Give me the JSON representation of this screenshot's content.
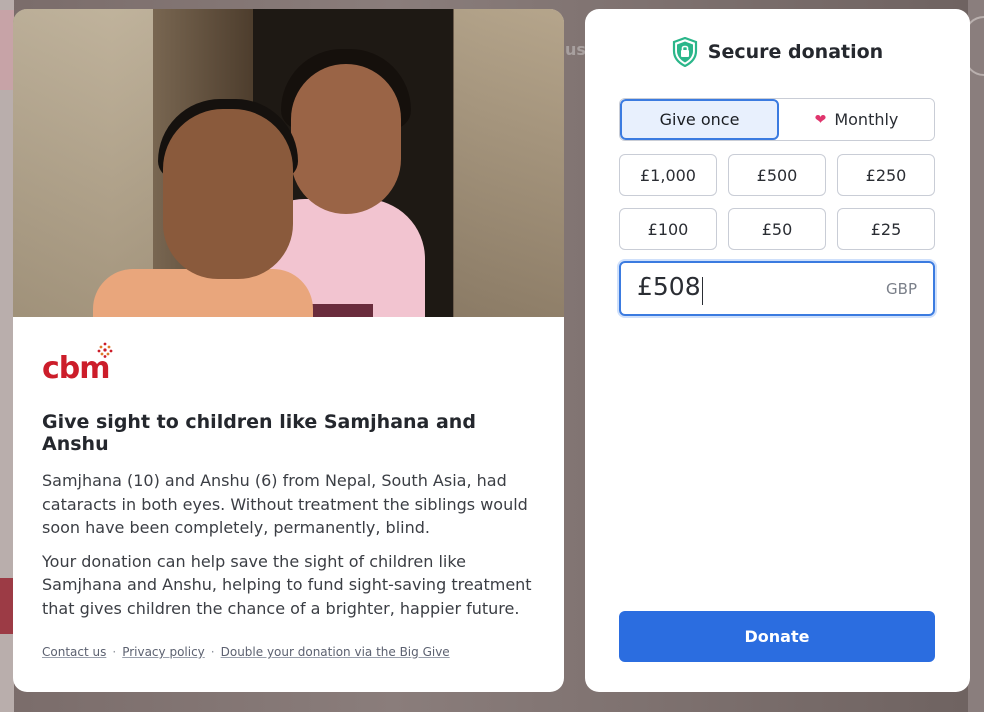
{
  "background": {
    "partial_text": "us"
  },
  "campaign": {
    "logo_text": "cbm",
    "title": "Give sight to children like Samjhana and Anshu",
    "paragraphs": [
      "Samjhana (10) and Anshu (6) from Nepal, South Asia, had cataracts in both eyes. Without treatment the siblings would soon have been completely, permanently, blind.",
      "Your donation can help save the sight of children like Samjhana and Anshu, helping to fund sight-saving treatment that gives children the chance of a brighter, happier future."
    ],
    "footer_links": [
      "Contact us",
      "Privacy policy",
      "Double your donation via the Big Give"
    ],
    "footer_separator": "·"
  },
  "donation": {
    "header_title": "Secure donation",
    "header_icon": "shield-lock-icon",
    "frequency": {
      "options": [
        "Give once",
        "Monthly"
      ],
      "selected": "Give once"
    },
    "amounts": [
      "£1,000",
      "£500",
      "£250",
      "£100",
      "£50",
      "£25"
    ],
    "custom_amount": "£508",
    "currency": "GBP",
    "submit_label": "Donate"
  },
  "colors": {
    "accent": "#2b6de0",
    "brand": "#cc1d2a",
    "shield": "#2bb68a",
    "heart": "#e0356d"
  }
}
